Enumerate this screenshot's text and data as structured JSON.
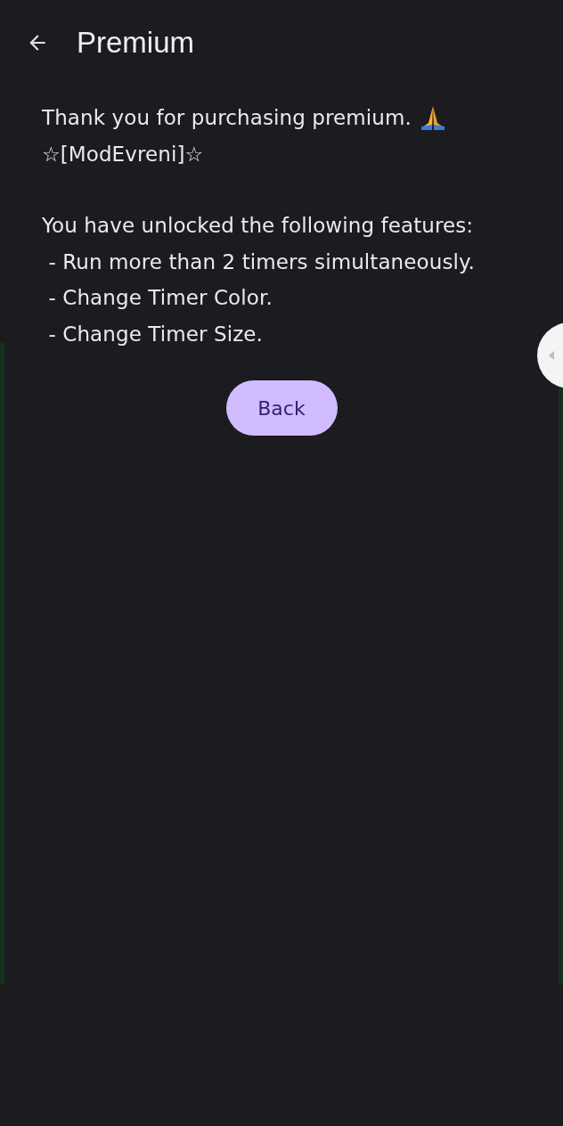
{
  "app_bar": {
    "title": "Premium"
  },
  "message": {
    "paragraphs": [
      [
        {
          "text": "Thank you for purchasing premium.",
          "kind": "emoji-line"
        },
        {
          "text": "☆[ModEvreni]☆",
          "kind": "plain"
        }
      ],
      [
        {
          "text": "You have unlocked the following features:",
          "kind": "plain"
        },
        {
          "text": " - Run more than 2 timers simultaneously.",
          "kind": "plain"
        },
        {
          "text": " - Change Timer Color.",
          "kind": "plain"
        },
        {
          "text": " - Change Timer Size.",
          "kind": "plain"
        }
      ]
    ]
  },
  "buttons": [
    {
      "label": "Back"
    }
  ]
}
